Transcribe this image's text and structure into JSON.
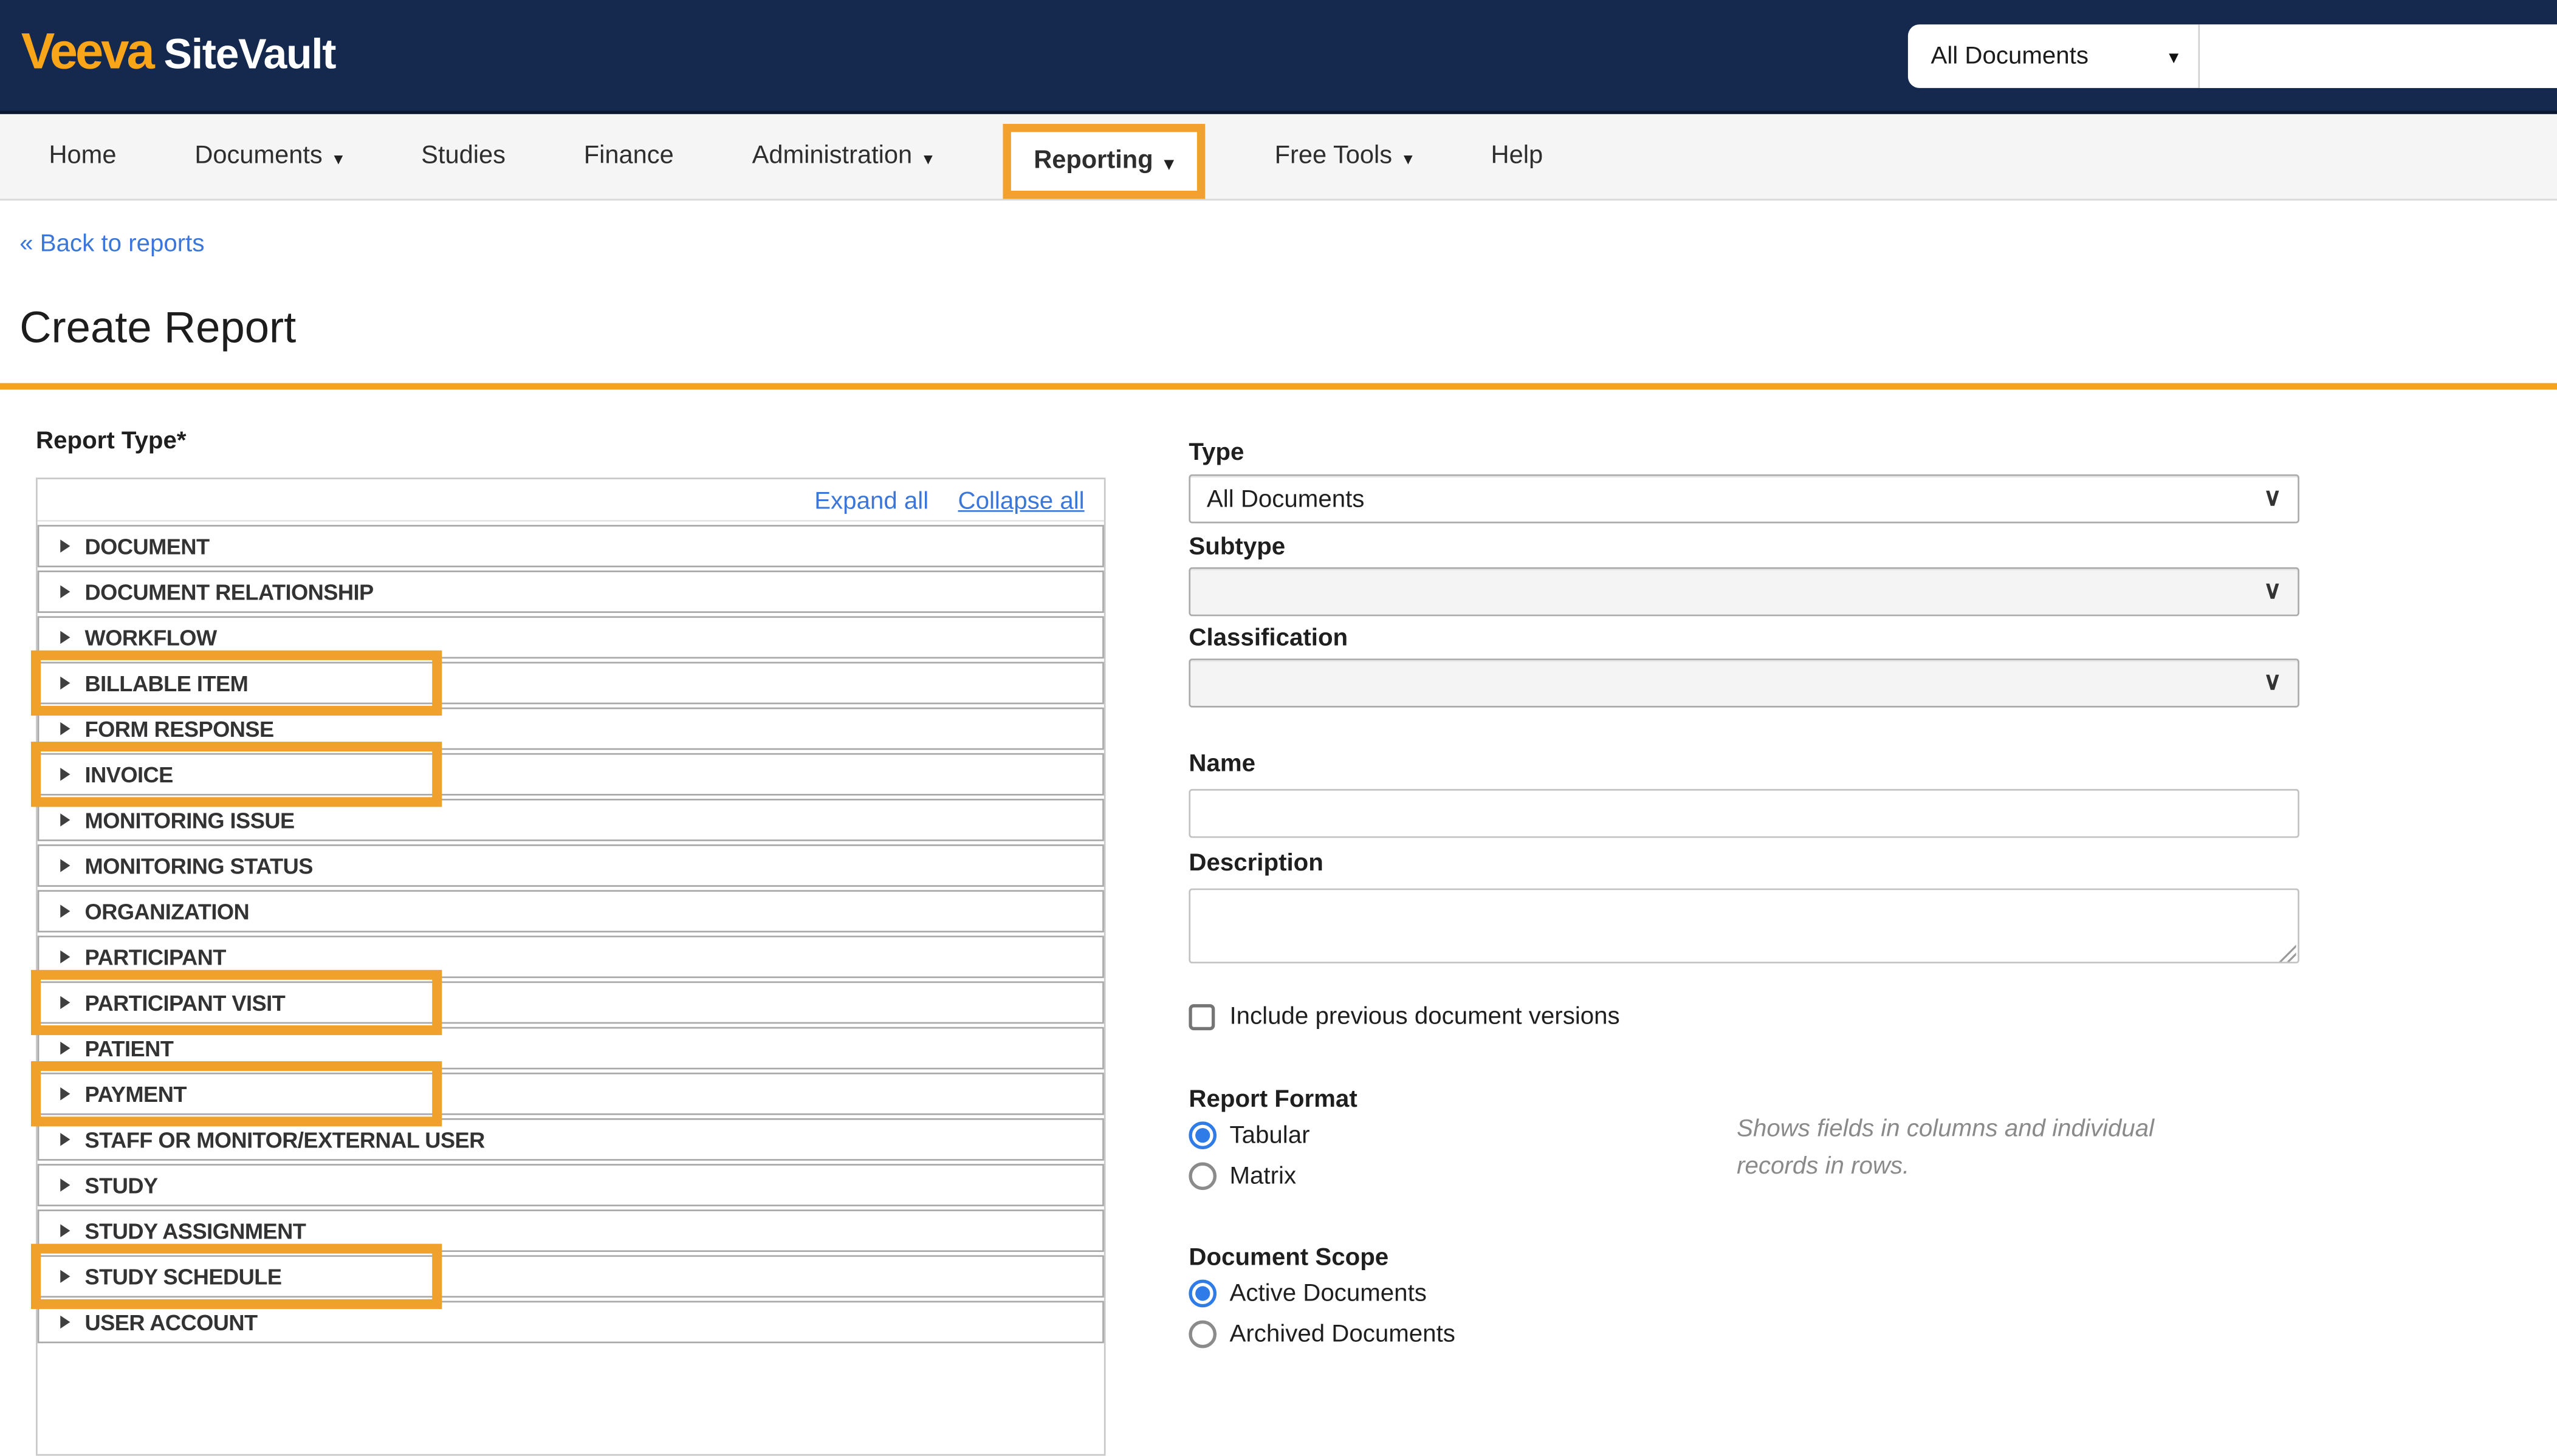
{
  "header": {
    "brand_veeva": "Veeva",
    "brand_product": "SiteVault",
    "scope_selector_value": "All Documents",
    "caret_char": "▾"
  },
  "nav": {
    "caret_char": "▾",
    "items": [
      {
        "label": "Home",
        "caret": false,
        "highlighted": false
      },
      {
        "label": "Documents",
        "caret": true,
        "highlighted": false
      },
      {
        "label": "Studies",
        "caret": false,
        "highlighted": false
      },
      {
        "label": "Finance",
        "caret": false,
        "highlighted": false
      },
      {
        "label": "Administration",
        "caret": true,
        "highlighted": false
      },
      {
        "label": "Reporting",
        "caret": true,
        "highlighted": true
      },
      {
        "label": "Free Tools",
        "caret": true,
        "highlighted": false
      },
      {
        "label": "Help",
        "caret": false,
        "highlighted": false
      }
    ]
  },
  "breadcrumb": {
    "back_link": "« Back to reports"
  },
  "page": {
    "title": "Create Report"
  },
  "report_type": {
    "label": "Report Type*",
    "expand_all": "Expand all",
    "collapse_all": "Collapse all",
    "expander_icon": "triangle-right",
    "items": [
      {
        "label": "DOCUMENT",
        "highlighted": false
      },
      {
        "label": "DOCUMENT RELATIONSHIP",
        "highlighted": false
      },
      {
        "label": "WORKFLOW",
        "highlighted": false
      },
      {
        "label": "BILLABLE ITEM",
        "highlighted": true
      },
      {
        "label": "FORM RESPONSE",
        "highlighted": false
      },
      {
        "label": "INVOICE",
        "highlighted": true
      },
      {
        "label": "MONITORING ISSUE",
        "highlighted": false
      },
      {
        "label": "MONITORING STATUS",
        "highlighted": false
      },
      {
        "label": "ORGANIZATION",
        "highlighted": false
      },
      {
        "label": "PARTICIPANT",
        "highlighted": false
      },
      {
        "label": "PARTICIPANT VISIT",
        "highlighted": true
      },
      {
        "label": "PATIENT",
        "highlighted": false
      },
      {
        "label": "PAYMENT",
        "highlighted": true
      },
      {
        "label": "STAFF OR MONITOR/EXTERNAL USER",
        "highlighted": false
      },
      {
        "label": "STUDY",
        "highlighted": false
      },
      {
        "label": "STUDY ASSIGNMENT",
        "highlighted": false
      },
      {
        "label": "STUDY SCHEDULE",
        "highlighted": true
      },
      {
        "label": "USER ACCOUNT",
        "highlighted": false
      }
    ]
  },
  "form": {
    "select_chevron": "∨",
    "type_label": "Type",
    "type_value": "All Documents",
    "subtype_label": "Subtype",
    "subtype_value": "",
    "classification_label": "Classification",
    "classification_value": "",
    "name_label": "Name",
    "name_value": "",
    "description_label": "Description",
    "description_value": "",
    "include_versions_label": "Include previous document versions",
    "include_versions_checked": false,
    "report_format": {
      "label": "Report Format",
      "options": [
        {
          "label": "Tabular"
        },
        {
          "label": "Matrix"
        }
      ],
      "selected": "Tabular",
      "note": "Shows fields in columns and individual records in rows."
    },
    "document_scope": {
      "label": "Document Scope",
      "options": [
        {
          "label": "Active Documents"
        },
        {
          "label": "Archived Documents"
        }
      ],
      "selected": "Active Documents"
    }
  },
  "colors": {
    "header_bg": "#15294E",
    "accent_orange": "#F2A12F",
    "divider_orange": "#F5A31C",
    "logo_orange": "#F9A51A",
    "link_blue": "#3B76D9",
    "radio_blue": "#2F7BE8"
  }
}
